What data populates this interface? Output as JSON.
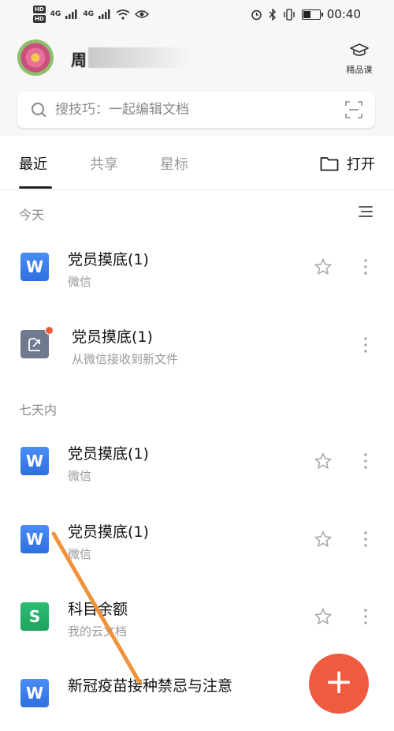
{
  "status_bar": {
    "hd1": "HD",
    "hd2": "HD",
    "net1": "4G",
    "net2": "4G",
    "time": "00:40",
    "battery_level": 0.45
  },
  "header": {
    "username": "周",
    "course_label": "精品课"
  },
  "search": {
    "placeholder": "搜技巧：一起编辑文档"
  },
  "tabs": [
    {
      "label": "最近"
    },
    {
      "label": "共享"
    },
    {
      "label": "星标"
    }
  ],
  "open_label": "打开",
  "sections": {
    "today": "今天",
    "week": "七天内"
  },
  "files": [
    {
      "name": "党员摸底(1)",
      "source": "微信",
      "icon": "W"
    },
    {
      "name": "党员摸底(1)",
      "source": "从微信接收到新文件",
      "icon": "share"
    },
    {
      "name": "党员摸底(1)",
      "source": "微信",
      "icon": "W"
    },
    {
      "name": "党员摸底(1)",
      "source": "微信",
      "icon": "W"
    },
    {
      "name": "科目余额",
      "source": "我的云文档",
      "icon": "S"
    },
    {
      "name": "新冠疫苗接种禁忌与注意",
      "source": "",
      "icon": "W"
    }
  ],
  "fab_label": "+",
  "colors": {
    "accent": "#f05a3f",
    "writer_blue": "#2f6fe0",
    "sheet_green": "#1ea35f",
    "annotation_orange": "#f0923a"
  }
}
